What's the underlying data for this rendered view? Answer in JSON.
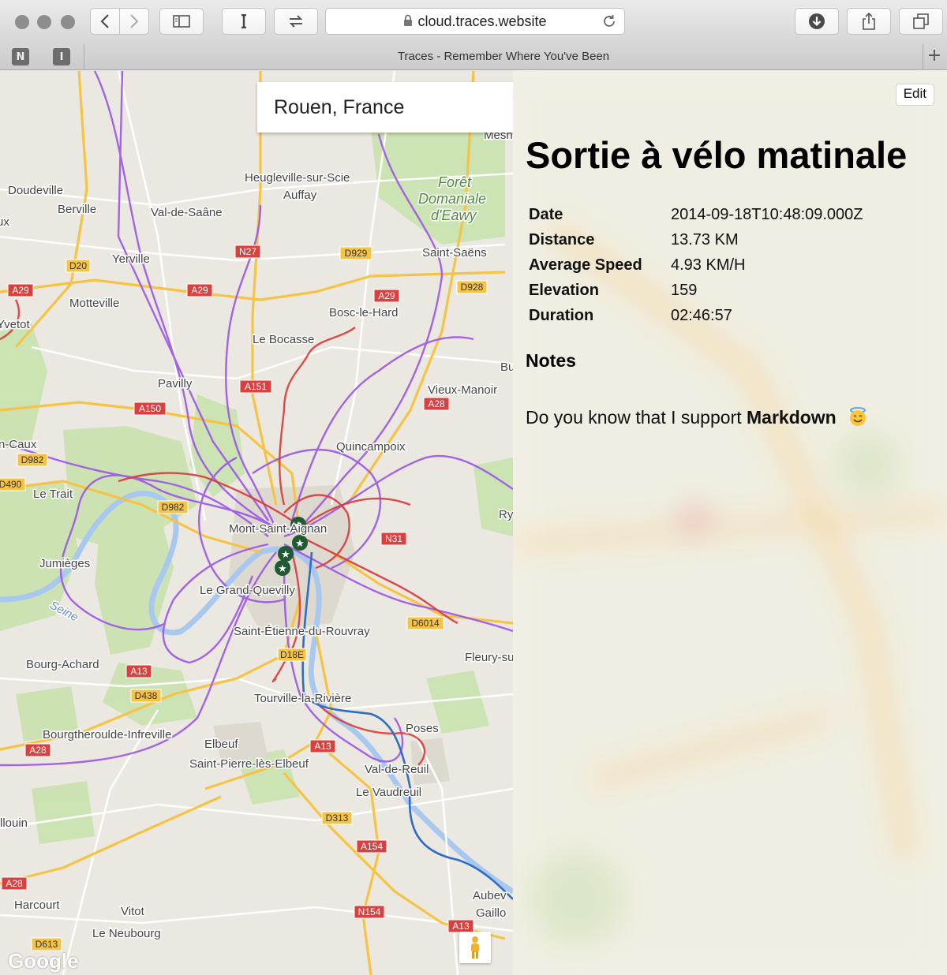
{
  "browser": {
    "url": "cloud.traces.website",
    "tab_title": "Traces - Remember Where You've Been",
    "pinned_tabs": [
      "N",
      "I"
    ]
  },
  "map": {
    "search_value": "Rouen, France",
    "provider_logo": "Google",
    "places": [
      "Doudeville",
      "Berville",
      "Val-de-Saâne",
      "Heugleville-sur-Scie",
      "Auffay",
      "Forêt",
      "Domaniale",
      "d'Eawy",
      "Saint-Saëns",
      "Yerville",
      "Motteville",
      "Yvetot",
      "Bosc-le-Hard",
      "Le Bocasse",
      "Pavilly",
      "Vieux-Manoir",
      "Quincampoix",
      "Le Trait",
      "Mont-Saint-Aignan",
      "Jumièges",
      "Le Grand-Quevilly",
      "Saint-Étienne-du-Rouvray",
      "Fleury-su",
      "Bourg-Achard",
      "Tourville-la-Rivière",
      "Poses",
      "Bourgtheroulde-Infreville",
      "Elbeuf",
      "Saint-Pierre-lès-Elbeuf",
      "Val-de-Reuil",
      "Le Vaudreuil",
      "llouin",
      "Harcourt",
      "Vitot",
      "Le Neubourg",
      "Aubev",
      "Gaillo",
      "n-Caux",
      "ux",
      "Seine",
      "Ry",
      "Bu",
      "Mesn"
    ],
    "roads": [
      "D20",
      "A29",
      "N27",
      "D929",
      "D928",
      "A151",
      "A150",
      "D982",
      "D490",
      "N31",
      "D6014",
      "D18E",
      "A13",
      "D438",
      "A28",
      "D313",
      "A154",
      "N154",
      "D613"
    ]
  },
  "panel": {
    "edit_label": "Edit",
    "title": "Sortie à vélo matinale",
    "fields": [
      {
        "label": "Date",
        "value": "2014-09-18T10:48:09.000Z"
      },
      {
        "label": "Distance",
        "value": "13.73 KM"
      },
      {
        "label": "Average Speed",
        "value": "4.93 KM/H"
      },
      {
        "label": "Elevation",
        "value": "159"
      },
      {
        "label": "Duration",
        "value": "02:46:57"
      }
    ],
    "notes_heading": "Notes",
    "notes_text_before": "Do you know that I support",
    "notes_bold": "Markdown",
    "notes_emoji": "smiling-face-with-halo-icon"
  },
  "colors": {
    "trace_purple": "#9b55e8",
    "trace_red": "#d93a3a",
    "trace_blue": "#2f6dc6",
    "marker_green": "#1f5a32",
    "highway": "#f5c242",
    "forest": "#c7e0ac"
  }
}
